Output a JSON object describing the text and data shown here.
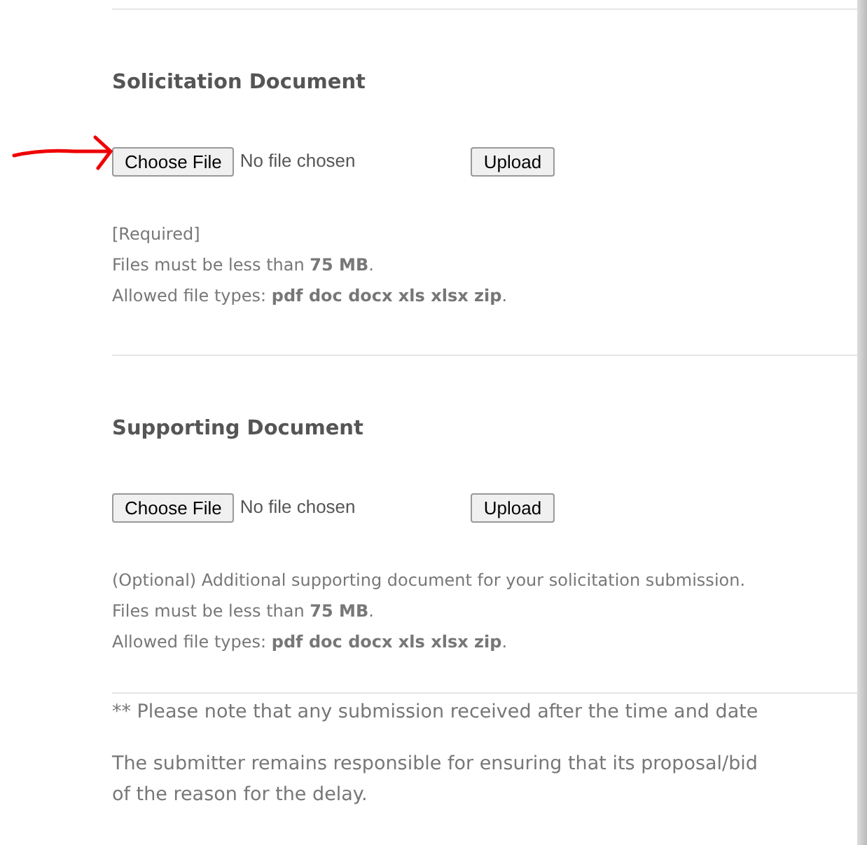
{
  "sections": [
    {
      "title": "Solicitation Document",
      "file_button": "Choose File",
      "file_status": "No file chosen",
      "upload_button": "Upload",
      "notes": [
        "[Required]",
        "Files must be less than **75 MB**.",
        "Allowed file types: **pdf doc docx xls xlsx zip**."
      ]
    },
    {
      "title": "Supporting Document",
      "file_button": "Choose File",
      "file_status": "No file chosen",
      "upload_button": "Upload",
      "notes": [
        "(Optional) Additional supporting document for your solicitation submission.",
        "Files must be less than **75 MB**.",
        "Allowed file types: **pdf doc docx xls xlsx zip**."
      ]
    }
  ],
  "annotation": {
    "kind": "arrow"
  },
  "footer_notes": [
    "** Please note that any submission received after the time and date",
    "The submitter remains responsible for ensuring that its proposal/bid",
    "of the reason for the delay."
  ]
}
